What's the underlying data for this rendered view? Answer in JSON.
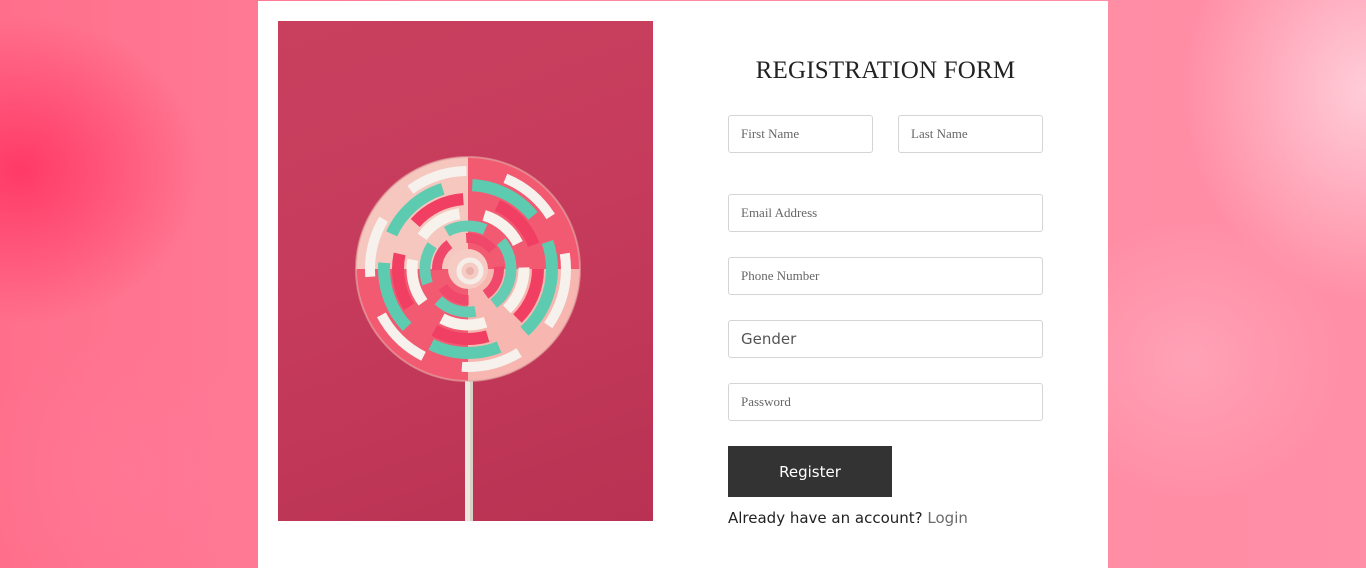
{
  "image": {
    "icon": "lollipop-photo"
  },
  "form": {
    "title": "REGISTRATION FORM",
    "first_name_placeholder": "First Name",
    "last_name_placeholder": "Last Name",
    "email_placeholder": "Email Address",
    "phone_placeholder": "Phone Number",
    "gender_label": "Gender",
    "password_placeholder": "Password",
    "register_label": "Register",
    "account_text": "Already have an account?",
    "login_label": "Login"
  },
  "colors": {
    "button": "#333333",
    "photo_background": "#c63b5b",
    "login_link": "#6b6b6b"
  }
}
